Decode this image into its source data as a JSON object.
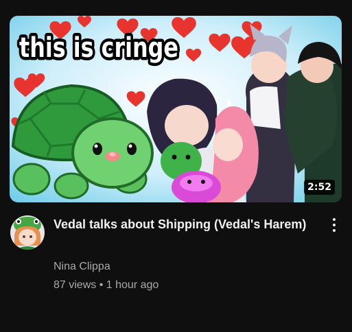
{
  "video": {
    "thumbnail_text": "this is cringe",
    "duration": "2:52",
    "title": "Vedal talks about Shipping (Vedal's Harem)",
    "channel": "Nina Clippa",
    "views": "87 views",
    "separator": "•",
    "age": "1 hour ago"
  },
  "icons": {
    "menu": "more-vert-icon"
  },
  "colors": {
    "background": "#0f0f0f",
    "title": "#f1f1f1",
    "secondary_text": "#aaaaaa",
    "heart": "#e8342e",
    "turtle": "#3fae4a"
  }
}
